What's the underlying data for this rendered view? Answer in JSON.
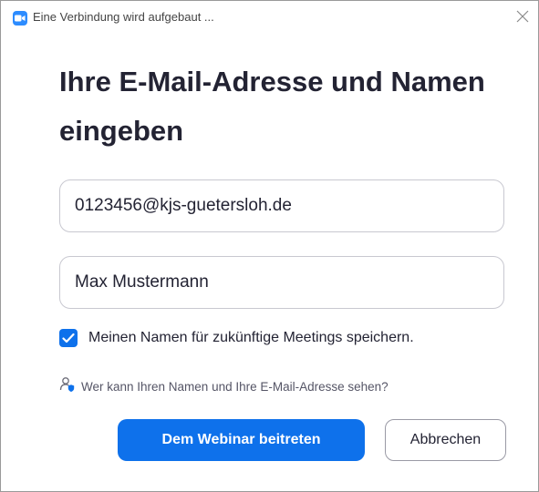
{
  "window": {
    "title": "Eine Verbindung wird aufgebaut ...",
    "app_icon": "zoom-camera-icon",
    "close_icon": "close-icon"
  },
  "form": {
    "heading": "Ihre E-Mail-Adresse und Namen eingeben",
    "email_value": "0123456@kjs-guetersloh.de",
    "name_value": "Max Mustermann",
    "remember_checked": true,
    "remember_label": "Meinen Namen für zukünftige Meetings speichern.",
    "privacy_icon": "user-shield-icon",
    "privacy_link": "Wer kann Ihren Namen und Ihre E-Mail-Adresse sehen?",
    "join_label": "Dem Webinar beitreten",
    "cancel_label": "Abbrechen"
  },
  "colors": {
    "accent": "#0e71eb",
    "zoom_brand": "#2d8cff",
    "text": "#232333",
    "border": "#c8c8d0"
  }
}
